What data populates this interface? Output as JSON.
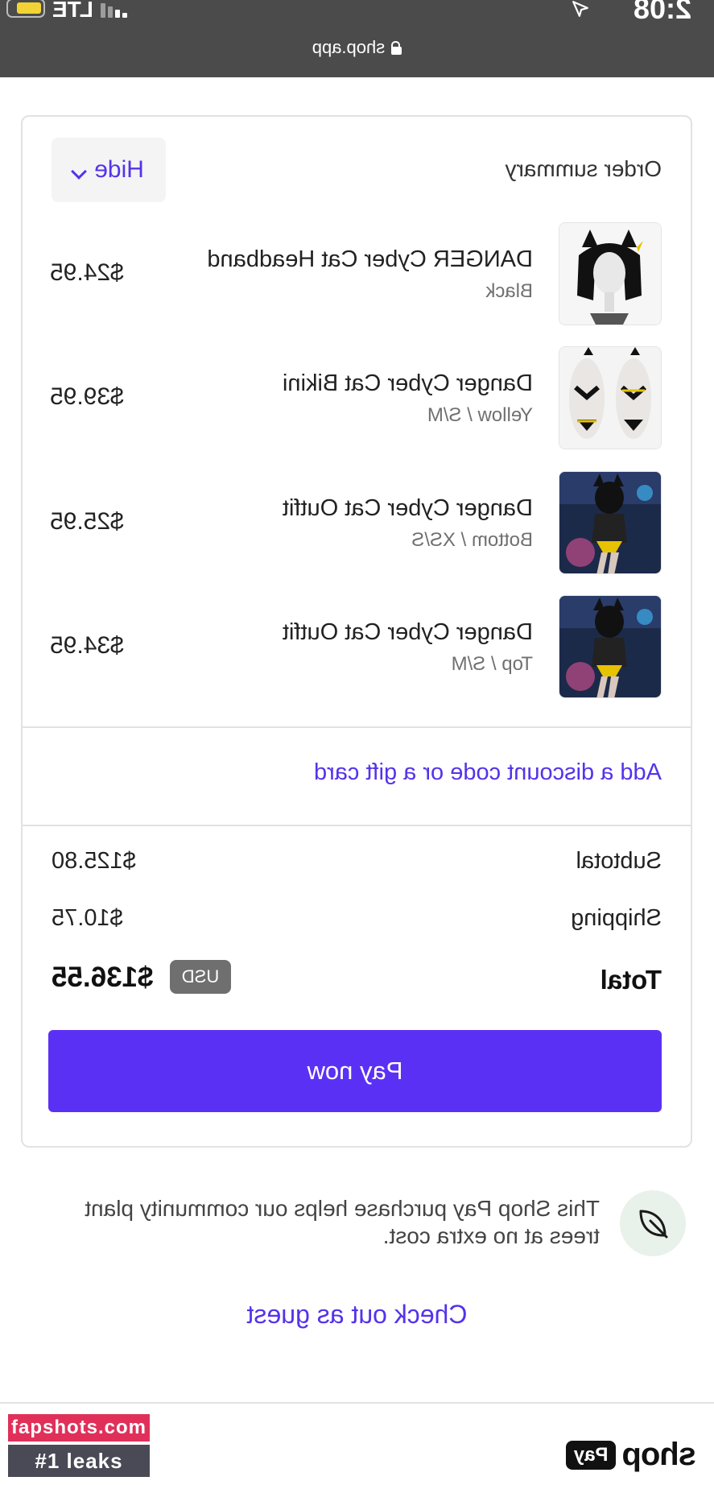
{
  "status_bar": {
    "time": "2:08",
    "carrier": "LTE",
    "url": "shop.app"
  },
  "order_summary": {
    "title": "Order summary",
    "toggle_label": "Hide",
    "items": [
      {
        "name": "DANGER Cyber Cat Headband",
        "variant": "Black",
        "price": "$24.95"
      },
      {
        "name": "Danger Cyber Cat Bikini",
        "variant": "Yellow / S/M",
        "price": "$39.95"
      },
      {
        "name": "Danger Cyber Cat Outfit",
        "variant": "Bottom / XS/S",
        "price": "$25.95"
      },
      {
        "name": "Danger Cyber Cat Outfit",
        "variant": "Top / S/M",
        "price": "$34.95"
      }
    ],
    "discount_link": "Add a discount code or a gift card",
    "subtotal_label": "Subtotal",
    "subtotal_value": "$125.80",
    "shipping_label": "Shipping",
    "shipping_value": "$10.75",
    "total_label": "Total",
    "currency": "USD",
    "total_value": "$136.55",
    "pay_button": "Pay now"
  },
  "trees_note": "This Shop Pay purchase helps our community plant trees at no extra cost.",
  "guest_link": "Check out as guest",
  "footer": {
    "logo_word": "shop",
    "logo_pill": "Pay"
  },
  "watermark": {
    "site": "fapshots.com",
    "tagline": "#1 leaks"
  },
  "colors": {
    "accent": "#5a31f4",
    "link": "#5433eb",
    "status_bar": "#4b4b4b"
  }
}
